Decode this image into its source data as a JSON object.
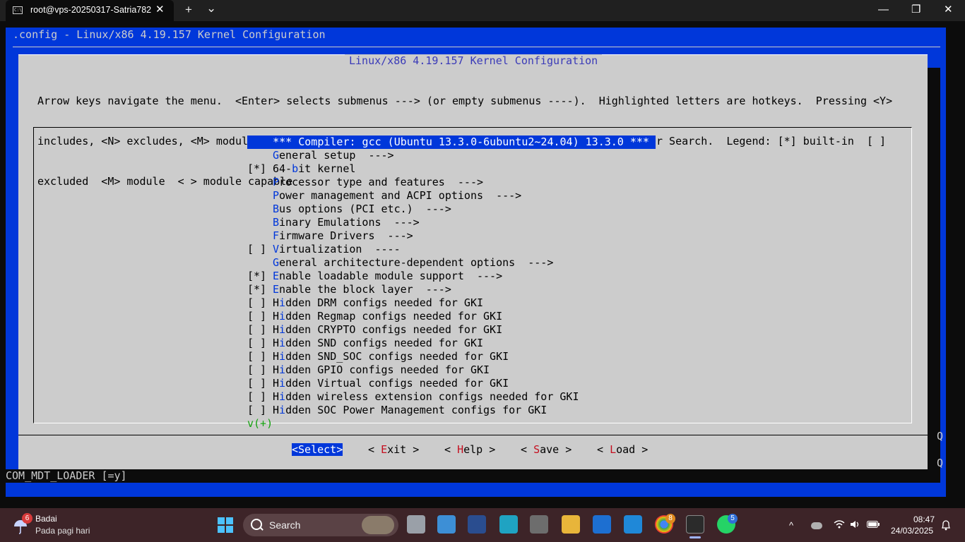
{
  "window": {
    "tab_title": "root@vps-20250317-Satria782",
    "tab_icon": "cmd-icon",
    "new_tab": "+",
    "tab_dropdown": "⌄",
    "close_tab": "✕",
    "minimize": "—",
    "maximize": "❐",
    "close": "✕"
  },
  "terminal": {
    "config_title": ".config - Linux/x86 4.19.157 Kernel Configuration",
    "side_markers": [
      "Q",
      "Q"
    ],
    "status_line": "COM_MDT_LOADER [=y]",
    "dialog": {
      "title": "Linux/x86 4.19.157 Kernel Configuration",
      "help_lines": [
        "Arrow keys navigate the menu.  <Enter> selects submenus ---> (or empty submenus ----).  Highlighted letters are hotkeys.  Pressing <Y>",
        "includes, <N> excludes, <M> modularizes features.  Press <Esc><Esc> to exit, <?> for Help, </> for Search.  Legend: [*] built-in  [ ]",
        "excluded  <M> module  < > module capable"
      ],
      "menu_items": [
        {
          "prefix": "",
          "hotkey": "",
          "text": "*** Compiler: gcc (Ubuntu 13.3.0-6ubuntu2~24.04) 13.3.0 ***",
          "selected": true
        },
        {
          "prefix": "",
          "hotkey": "G",
          "text": "eneral setup  --->"
        },
        {
          "prefix": "[*] ",
          "hotkey": "",
          "text": "64-",
          "hotkey2": "b",
          "text2": "it kernel"
        },
        {
          "prefix": "",
          "hotkey": "P",
          "text": "rocessor type and features  --->"
        },
        {
          "prefix": "",
          "hotkey": "P",
          "text": "ower management and ACPI options  --->"
        },
        {
          "prefix": "",
          "hotkey": "B",
          "text": "us options (PCI etc.)  --->"
        },
        {
          "prefix": "",
          "hotkey": "B",
          "text": "inary Emulations  --->"
        },
        {
          "prefix": "",
          "hotkey": "F",
          "text": "irmware Drivers  --->"
        },
        {
          "prefix": "[ ] ",
          "hotkey": "V",
          "text": "irtualization  ----"
        },
        {
          "prefix": "",
          "hotkey": "G",
          "text": "eneral architecture-dependent options  --->"
        },
        {
          "prefix": "[*] ",
          "hotkey": "E",
          "text": "nable loadable module support  --->"
        },
        {
          "prefix": "[*] ",
          "hotkey": "E",
          "text": "nable the block layer  --->"
        },
        {
          "prefix": "[ ] ",
          "lead": "H",
          "hotkey": "i",
          "text": "dden DRM configs needed for GKI"
        },
        {
          "prefix": "[ ] ",
          "lead": "H",
          "hotkey": "i",
          "text": "dden Regmap configs needed for GKI"
        },
        {
          "prefix": "[ ] ",
          "lead": "H",
          "hotkey": "i",
          "text": "dden CRYPTO configs needed for GKI"
        },
        {
          "prefix": "[ ] ",
          "lead": "H",
          "hotkey": "i",
          "text": "dden SND configs needed for GKI"
        },
        {
          "prefix": "[ ] ",
          "lead": "H",
          "hotkey": "i",
          "text": "dden SND_SOC configs needed for GKI"
        },
        {
          "prefix": "[ ] ",
          "lead": "H",
          "hotkey": "i",
          "text": "dden GPIO configs needed for GKI"
        },
        {
          "prefix": "[ ] ",
          "lead": "H",
          "hotkey": "i",
          "text": "dden Virtual configs needed for GKI"
        },
        {
          "prefix": "[ ] ",
          "lead": "H",
          "hotkey": "i",
          "text": "dden wireless extension configs needed for GKI"
        },
        {
          "prefix": "[ ] ",
          "lead": "H",
          "hotkey": "i",
          "text": "dden SOC Power Management configs for GKI"
        }
      ],
      "more_indicator": "v(+)",
      "buttons": [
        {
          "open": "<",
          "hotkey": "Select",
          "rest": "",
          "close": ">",
          "selected": true
        },
        {
          "open": "< ",
          "hotkey": "E",
          "rest": "xit",
          "close": " >"
        },
        {
          "open": "< ",
          "hotkey": "H",
          "rest": "elp",
          "close": " >"
        },
        {
          "open": "< ",
          "hotkey": "S",
          "rest": "ave",
          "close": " >"
        },
        {
          "open": "< ",
          "hotkey": "L",
          "rest": "oad",
          "close": " >"
        }
      ]
    }
  },
  "taskbar": {
    "weather_badge": "6",
    "weather_title": "Badai",
    "weather_subtitle": "Pada pagi hari",
    "search_placeholder": "Search",
    "chrome_badge": "8",
    "whatsapp_badge": "5",
    "time": "08:47",
    "date": "24/03/2025",
    "tray_chevron": "^",
    "colors": {
      "taskbar_bg": "#3d2428",
      "terminal_blue": "#0037da",
      "dialog_gray": "#cccccc"
    }
  }
}
